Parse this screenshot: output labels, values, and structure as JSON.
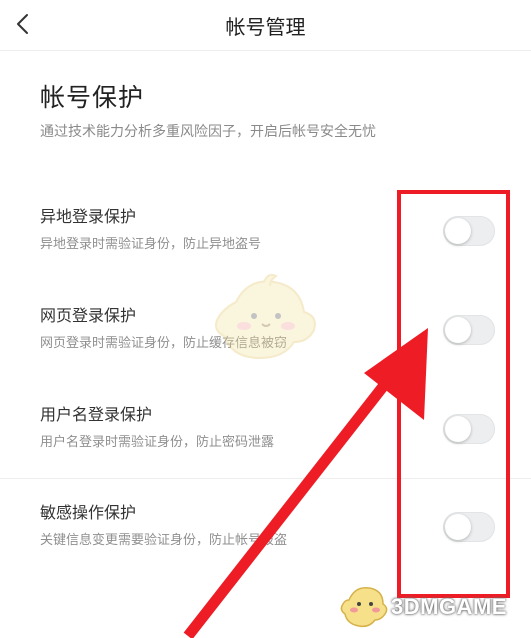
{
  "header": {
    "title": "帐号管理",
    "back_icon": "chevron-left-icon"
  },
  "section": {
    "title": "帐号保护",
    "description": "通过技术能力分析多重风险因子，开启后帐号安全无忧"
  },
  "settings": [
    {
      "title": "异地登录保护",
      "description": "异地登录时需验证身份，防止异地盗号",
      "enabled": false
    },
    {
      "title": "网页登录保护",
      "description": "网页登录时需验证身份，防止缓存信息被窃",
      "enabled": false
    },
    {
      "title": "用户名登录保护",
      "description": "用户名登录时需验证身份，防止密码泄露",
      "enabled": false
    },
    {
      "title": "敏感操作保护",
      "description": "关键信息变更需要验证身份，防止帐号被盗",
      "enabled": false
    }
  ],
  "annotation": {
    "highlight_color": "#ee1c25",
    "arrow_color": "#ee1c25"
  },
  "watermark": {
    "text": "3DMGAME"
  },
  "colors": {
    "toggle_off_track": "#eceeef",
    "toggle_knob": "#ffffff"
  }
}
